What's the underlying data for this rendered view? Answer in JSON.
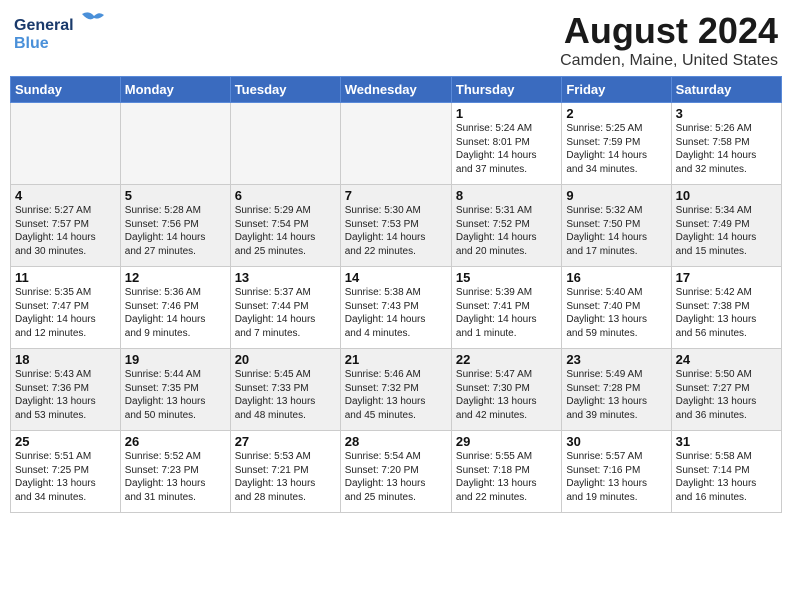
{
  "header": {
    "logo_general": "General",
    "logo_blue": "Blue",
    "title": "August 2024",
    "subtitle": "Camden, Maine, United States"
  },
  "days_of_week": [
    "Sunday",
    "Monday",
    "Tuesday",
    "Wednesday",
    "Thursday",
    "Friday",
    "Saturday"
  ],
  "weeks": [
    [
      {
        "day": "",
        "info": ""
      },
      {
        "day": "",
        "info": ""
      },
      {
        "day": "",
        "info": ""
      },
      {
        "day": "",
        "info": ""
      },
      {
        "day": "1",
        "info": "Sunrise: 5:24 AM\nSunset: 8:01 PM\nDaylight: 14 hours\nand 37 minutes."
      },
      {
        "day": "2",
        "info": "Sunrise: 5:25 AM\nSunset: 7:59 PM\nDaylight: 14 hours\nand 34 minutes."
      },
      {
        "day": "3",
        "info": "Sunrise: 5:26 AM\nSunset: 7:58 PM\nDaylight: 14 hours\nand 32 minutes."
      }
    ],
    [
      {
        "day": "4",
        "info": "Sunrise: 5:27 AM\nSunset: 7:57 PM\nDaylight: 14 hours\nand 30 minutes."
      },
      {
        "day": "5",
        "info": "Sunrise: 5:28 AM\nSunset: 7:56 PM\nDaylight: 14 hours\nand 27 minutes."
      },
      {
        "day": "6",
        "info": "Sunrise: 5:29 AM\nSunset: 7:54 PM\nDaylight: 14 hours\nand 25 minutes."
      },
      {
        "day": "7",
        "info": "Sunrise: 5:30 AM\nSunset: 7:53 PM\nDaylight: 14 hours\nand 22 minutes."
      },
      {
        "day": "8",
        "info": "Sunrise: 5:31 AM\nSunset: 7:52 PM\nDaylight: 14 hours\nand 20 minutes."
      },
      {
        "day": "9",
        "info": "Sunrise: 5:32 AM\nSunset: 7:50 PM\nDaylight: 14 hours\nand 17 minutes."
      },
      {
        "day": "10",
        "info": "Sunrise: 5:34 AM\nSunset: 7:49 PM\nDaylight: 14 hours\nand 15 minutes."
      }
    ],
    [
      {
        "day": "11",
        "info": "Sunrise: 5:35 AM\nSunset: 7:47 PM\nDaylight: 14 hours\nand 12 minutes."
      },
      {
        "day": "12",
        "info": "Sunrise: 5:36 AM\nSunset: 7:46 PM\nDaylight: 14 hours\nand 9 minutes."
      },
      {
        "day": "13",
        "info": "Sunrise: 5:37 AM\nSunset: 7:44 PM\nDaylight: 14 hours\nand 7 minutes."
      },
      {
        "day": "14",
        "info": "Sunrise: 5:38 AM\nSunset: 7:43 PM\nDaylight: 14 hours\nand 4 minutes."
      },
      {
        "day": "15",
        "info": "Sunrise: 5:39 AM\nSunset: 7:41 PM\nDaylight: 14 hours\nand 1 minute."
      },
      {
        "day": "16",
        "info": "Sunrise: 5:40 AM\nSunset: 7:40 PM\nDaylight: 13 hours\nand 59 minutes."
      },
      {
        "day": "17",
        "info": "Sunrise: 5:42 AM\nSunset: 7:38 PM\nDaylight: 13 hours\nand 56 minutes."
      }
    ],
    [
      {
        "day": "18",
        "info": "Sunrise: 5:43 AM\nSunset: 7:36 PM\nDaylight: 13 hours\nand 53 minutes."
      },
      {
        "day": "19",
        "info": "Sunrise: 5:44 AM\nSunset: 7:35 PM\nDaylight: 13 hours\nand 50 minutes."
      },
      {
        "day": "20",
        "info": "Sunrise: 5:45 AM\nSunset: 7:33 PM\nDaylight: 13 hours\nand 48 minutes."
      },
      {
        "day": "21",
        "info": "Sunrise: 5:46 AM\nSunset: 7:32 PM\nDaylight: 13 hours\nand 45 minutes."
      },
      {
        "day": "22",
        "info": "Sunrise: 5:47 AM\nSunset: 7:30 PM\nDaylight: 13 hours\nand 42 minutes."
      },
      {
        "day": "23",
        "info": "Sunrise: 5:49 AM\nSunset: 7:28 PM\nDaylight: 13 hours\nand 39 minutes."
      },
      {
        "day": "24",
        "info": "Sunrise: 5:50 AM\nSunset: 7:27 PM\nDaylight: 13 hours\nand 36 minutes."
      }
    ],
    [
      {
        "day": "25",
        "info": "Sunrise: 5:51 AM\nSunset: 7:25 PM\nDaylight: 13 hours\nand 34 minutes."
      },
      {
        "day": "26",
        "info": "Sunrise: 5:52 AM\nSunset: 7:23 PM\nDaylight: 13 hours\nand 31 minutes."
      },
      {
        "day": "27",
        "info": "Sunrise: 5:53 AM\nSunset: 7:21 PM\nDaylight: 13 hours\nand 28 minutes."
      },
      {
        "day": "28",
        "info": "Sunrise: 5:54 AM\nSunset: 7:20 PM\nDaylight: 13 hours\nand 25 minutes."
      },
      {
        "day": "29",
        "info": "Sunrise: 5:55 AM\nSunset: 7:18 PM\nDaylight: 13 hours\nand 22 minutes."
      },
      {
        "day": "30",
        "info": "Sunrise: 5:57 AM\nSunset: 7:16 PM\nDaylight: 13 hours\nand 19 minutes."
      },
      {
        "day": "31",
        "info": "Sunrise: 5:58 AM\nSunset: 7:14 PM\nDaylight: 13 hours\nand 16 minutes."
      }
    ]
  ]
}
